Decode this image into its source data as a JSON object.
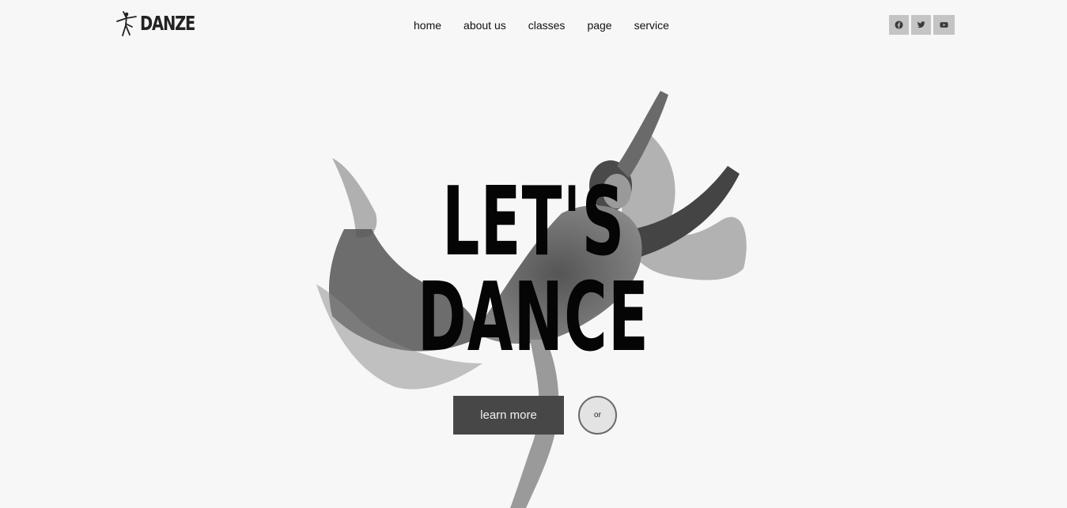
{
  "brand": {
    "name": "DANZE",
    "logo_icon": "dancer-icon"
  },
  "nav": {
    "items": [
      {
        "label": "home"
      },
      {
        "label": "about us"
      },
      {
        "label": "classes"
      },
      {
        "label": "page"
      },
      {
        "label": "service"
      }
    ]
  },
  "social": [
    {
      "icon": "facebook-icon"
    },
    {
      "icon": "twitter-icon"
    },
    {
      "icon": "youtube-icon"
    }
  ],
  "hero": {
    "line1": "LET'S",
    "line2": "DANCE",
    "cta_label": "learn more",
    "or_label": "or",
    "image": "dancer-photo"
  },
  "colors": {
    "background": "#f7f7f7",
    "cta_bg": "#474747",
    "social_bg": "#c4c4c4"
  }
}
